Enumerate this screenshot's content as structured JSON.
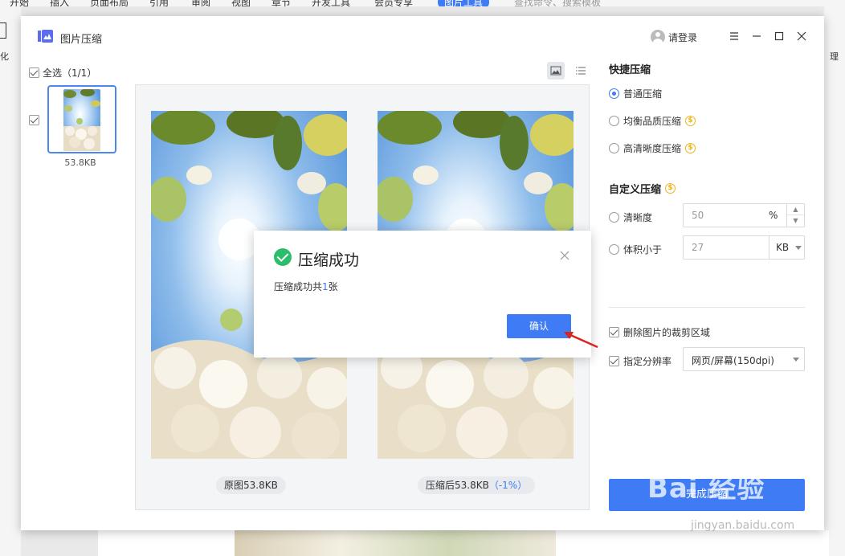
{
  "ribbon": {
    "tabs": [
      "开始",
      "插入",
      "页面布局",
      "引用",
      "审阅",
      "视图",
      "章节",
      "开发工具",
      "会员专享"
    ],
    "active_tab": "图片工具",
    "search_placeholder": "查找命令、搜索模板",
    "left_hint": "化",
    "right_hint": "理"
  },
  "window": {
    "title": "图片压缩",
    "login_label": "请登录"
  },
  "thumbs": {
    "select_all": "全选（1/1）",
    "items": [
      {
        "size": "53.8KB",
        "checked": true
      }
    ]
  },
  "preview": {
    "original_caption": "原图53.8KB",
    "compressed_caption": "压缩后53.8KB",
    "compressed_percent": "（-1%）"
  },
  "quick": {
    "title": "快捷压缩",
    "options": [
      {
        "label": "普通压缩",
        "selected": true,
        "vip": false
      },
      {
        "label": "均衡品质压缩",
        "selected": false,
        "vip": true
      },
      {
        "label": "高清晰度压缩",
        "selected": false,
        "vip": true
      }
    ]
  },
  "custom": {
    "title": "自定义压缩",
    "clarity_label": "清晰度",
    "clarity_value": "50",
    "clarity_unit": "%",
    "size_label": "体积小于",
    "size_value": "27",
    "size_unit": "KB"
  },
  "extras": {
    "crop_label": "删除图片的裁剪区域",
    "crop_checked": true,
    "dpi_label": "指定分辨率",
    "dpi_checked": true,
    "dpi_value": "网页/屏幕(150dpi)"
  },
  "finish_label": "完成压缩",
  "dialog": {
    "title": "压缩成功",
    "msg_prefix": "压缩成功共",
    "msg_count": "1",
    "msg_suffix": "张",
    "confirm_label": "确认"
  },
  "watermark": {
    "text": "Bai  经验",
    "sub": "jingyan.baidu.com"
  },
  "colors": {
    "accent": "#3e7bf5",
    "success": "#2cbd6c",
    "vip": "#f0b418"
  }
}
